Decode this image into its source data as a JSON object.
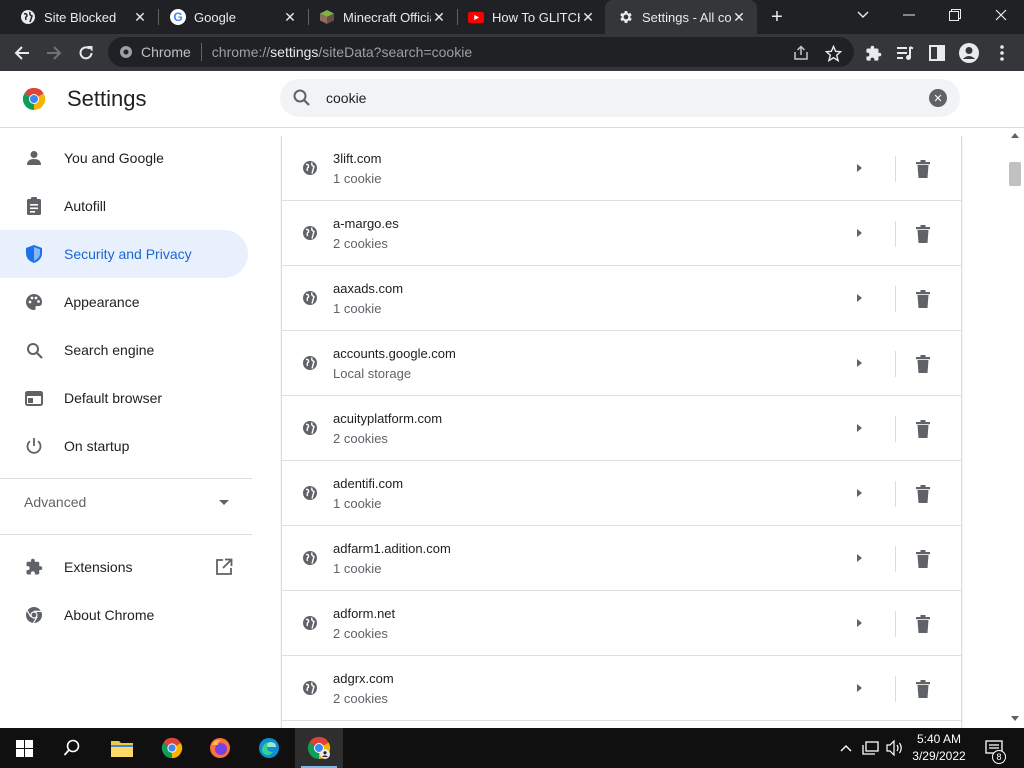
{
  "browser": {
    "tabs": [
      {
        "title": "Site Blocked",
        "icon": "globe-icon",
        "active": false
      },
      {
        "title": "Google",
        "icon": "google-g-icon",
        "active": false
      },
      {
        "title": "Minecraft Official",
        "icon": "minecraft-icon",
        "active": false
      },
      {
        "title": "How To GLITCH",
        "icon": "youtube-icon",
        "active": false
      },
      {
        "title": "Settings - All cookies",
        "icon": "gear-icon",
        "active": true
      }
    ],
    "omnibox": {
      "chip": "Chrome",
      "url_prefix": "chrome://",
      "url_host": "settings",
      "url_path": "/siteData?search=cookie"
    }
  },
  "settings": {
    "title": "Settings",
    "search_value": "cookie"
  },
  "sidebar": {
    "items": [
      {
        "label": "You and Google",
        "icon": "person-icon"
      },
      {
        "label": "Autofill",
        "icon": "clipboard-icon"
      },
      {
        "label": "Security and Privacy",
        "icon": "shield-icon",
        "selected": true
      },
      {
        "label": "Appearance",
        "icon": "palette-icon"
      },
      {
        "label": "Search engine",
        "icon": "search-icon"
      },
      {
        "label": "Default browser",
        "icon": "browser-window-icon"
      },
      {
        "label": "On startup",
        "icon": "power-icon"
      }
    ],
    "advanced": "Advanced",
    "extensions": "Extensions",
    "about": "About Chrome"
  },
  "sites": [
    {
      "site": "3lift.com",
      "detail": "1 cookie"
    },
    {
      "site": "a-margo.es",
      "detail": "2 cookies"
    },
    {
      "site": "aaxads.com",
      "detail": "1 cookie"
    },
    {
      "site": "accounts.google.com",
      "detail": "Local storage"
    },
    {
      "site": "acuityplatform.com",
      "detail": "2 cookies"
    },
    {
      "site": "adentifi.com",
      "detail": "1 cookie"
    },
    {
      "site": "adfarm1.adition.com",
      "detail": "1 cookie"
    },
    {
      "site": "adform.net",
      "detail": "2 cookies"
    },
    {
      "site": "adgrx.com",
      "detail": "2 cookies"
    }
  ],
  "taskbar": {
    "time": "5:40 AM",
    "date": "3/29/2022",
    "notifications": "8"
  },
  "colors": {
    "accent": "#1a73e8",
    "selected_bg": "#e8f0fe",
    "titlebar": "#202124",
    "toolbar": "#35363a"
  }
}
